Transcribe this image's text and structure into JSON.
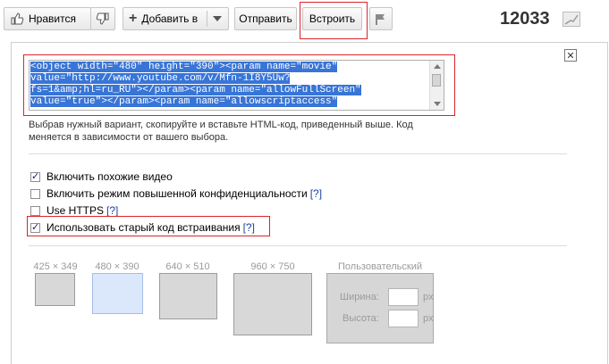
{
  "toolbar": {
    "like_label": "Нравится",
    "add_label": "Добавить в",
    "share_label": "Отправить",
    "embed_label": "Встроить",
    "view_count": "12033"
  },
  "embed": {
    "code_lines": [
      "<object width=\"480\" height=\"390\"><param name=\"movie\"",
      "value=\"http://www.youtube.com/v/Mfn-1I8Y5Uw?",
      "fs=1&amp;hl=ru_RU\"></param><param name=\"allowFullScreen\"",
      "value=\"true\"></param><param name=\"allowscriptaccess\""
    ],
    "help_text": "Выбрав нужный вариант, скопируйте и вставьте HTML-код, приведенный выше. Код меняется в зависимости от вашего выбора.",
    "options": [
      {
        "label": "Включить похожие видео",
        "checked": true,
        "help": ""
      },
      {
        "label": "Включить режим повышенной конфиденциальности",
        "checked": false,
        "help": "[?]"
      },
      {
        "label": "Use HTTPS",
        "checked": false,
        "help": "[?]"
      },
      {
        "label": "Использовать старый код встраивания",
        "checked": true,
        "help": "[?]"
      }
    ],
    "sizes": [
      {
        "label": "425 × 349",
        "selected": false
      },
      {
        "label": "480 × 390",
        "selected": true
      },
      {
        "label": "640 × 510",
        "selected": false
      },
      {
        "label": "960 × 750",
        "selected": false
      }
    ],
    "custom": {
      "title": "Пользовательский",
      "width_label": "Ширина:",
      "height_label": "Высота:",
      "unit": "px"
    }
  },
  "colors": {
    "highlight": "#d8262c",
    "selection": "#3875d7",
    "selected_size": "#dbe7fb"
  }
}
